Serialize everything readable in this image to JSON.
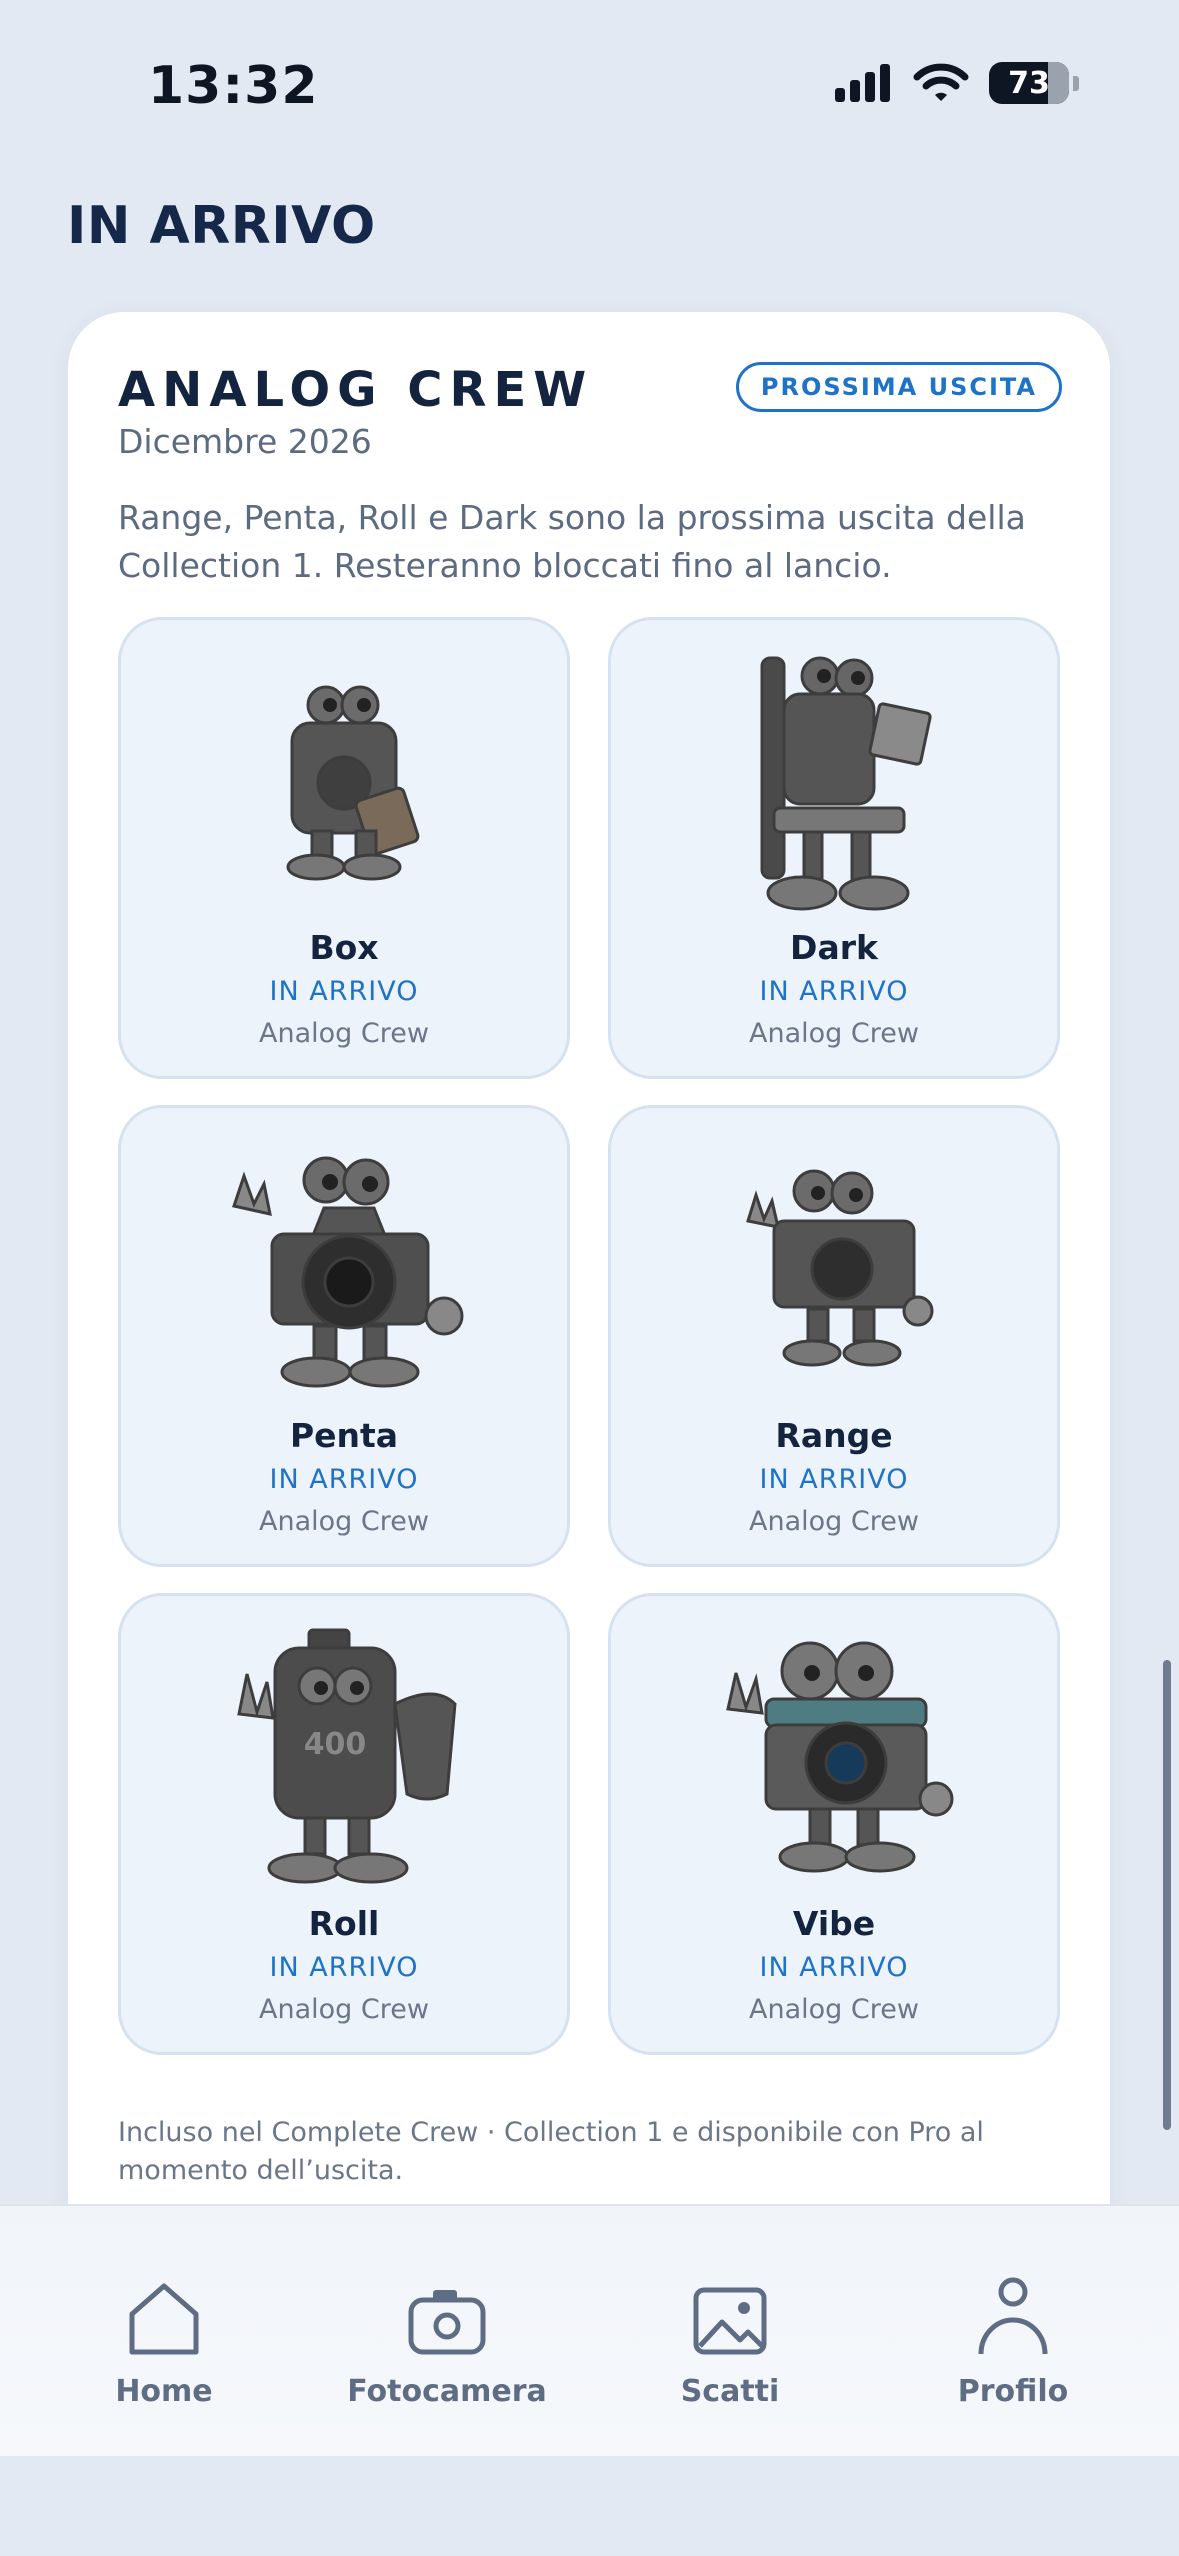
{
  "status_bar": {
    "time": "13:32",
    "battery": "73"
  },
  "section_title": "IN ARRIVO",
  "card": {
    "title": "ANALOG CREW",
    "date": "Dicembre 2026",
    "badge": "PROSSIMA USCITA",
    "description": "Range, Penta, Roll e Dark sono la prossima uscita della Collection 1. Resteranno bloccati fino al lancio.",
    "items": [
      {
        "name": "Box",
        "status": "IN ARRIVO",
        "crew": "Analog Crew",
        "icon": "box-camera-mascot-icon"
      },
      {
        "name": "Dark",
        "status": "IN ARRIVO",
        "crew": "Analog Crew",
        "icon": "darkroom-enlarger-mascot-icon"
      },
      {
        "name": "Penta",
        "status": "IN ARRIVO",
        "crew": "Analog Crew",
        "icon": "slr-camera-mascot-icon"
      },
      {
        "name": "Range",
        "status": "IN ARRIVO",
        "crew": "Analog Crew",
        "icon": "rangefinder-mascot-icon"
      },
      {
        "name": "Roll",
        "status": "IN ARRIVO",
        "crew": "Analog Crew",
        "icon": "film-roll-mascot-icon"
      },
      {
        "name": "Vibe",
        "status": "IN ARRIVO",
        "crew": "Analog Crew",
        "icon": "instant-camera-mascot-icon"
      }
    ],
    "footer": "Incluso nel Complete Crew · Collection 1 e disponibile con Pro al momento dell’uscita."
  },
  "tabbar": {
    "items": [
      {
        "label": "Home",
        "icon": "home-icon"
      },
      {
        "label": "Fotocamera",
        "icon": "camera-icon"
      },
      {
        "label": "Scatti",
        "icon": "photos-icon"
      },
      {
        "label": "Profilo",
        "icon": "profile-icon"
      }
    ]
  },
  "colors": {
    "accent": "#1e73c9",
    "title": "#14243f",
    "muted": "#5d6b82",
    "tile_bg": "#edf3fa"
  }
}
